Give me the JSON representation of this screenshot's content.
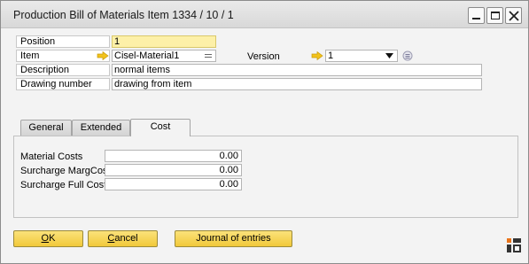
{
  "window": {
    "title": "Production Bill of Materials Item 1334 / 10 / 1"
  },
  "form": {
    "position": {
      "label": "Position",
      "value": "1"
    },
    "item": {
      "label": "Item",
      "value": "Cisel-Material1"
    },
    "version": {
      "label": "Version",
      "value": "1"
    },
    "description": {
      "label": "Description",
      "value": "normal items"
    },
    "drawing_number": {
      "label": "Drawing number",
      "value": "drawing from item"
    }
  },
  "tabs": [
    {
      "label": "General"
    },
    {
      "label": "Extended"
    },
    {
      "label": "Cost"
    }
  ],
  "cost": {
    "material_costs": {
      "label": "Material Costs",
      "value": "0.00"
    },
    "surcharge_margcost": {
      "label": "Surcharge MargCost",
      "value": "0.00"
    },
    "surcharge_full_cost": {
      "label": "Surcharge Full Cost",
      "value": "0.00"
    }
  },
  "buttons": {
    "ok": {
      "accel": "O",
      "rest": "K"
    },
    "cancel": {
      "accel": "C",
      "rest": "ancel"
    },
    "journal": "Journal of entries"
  },
  "colors": {
    "mandatory_field": "#fdf0a8",
    "button": "#f1c93a",
    "link_arrow": "#f2c21a"
  }
}
